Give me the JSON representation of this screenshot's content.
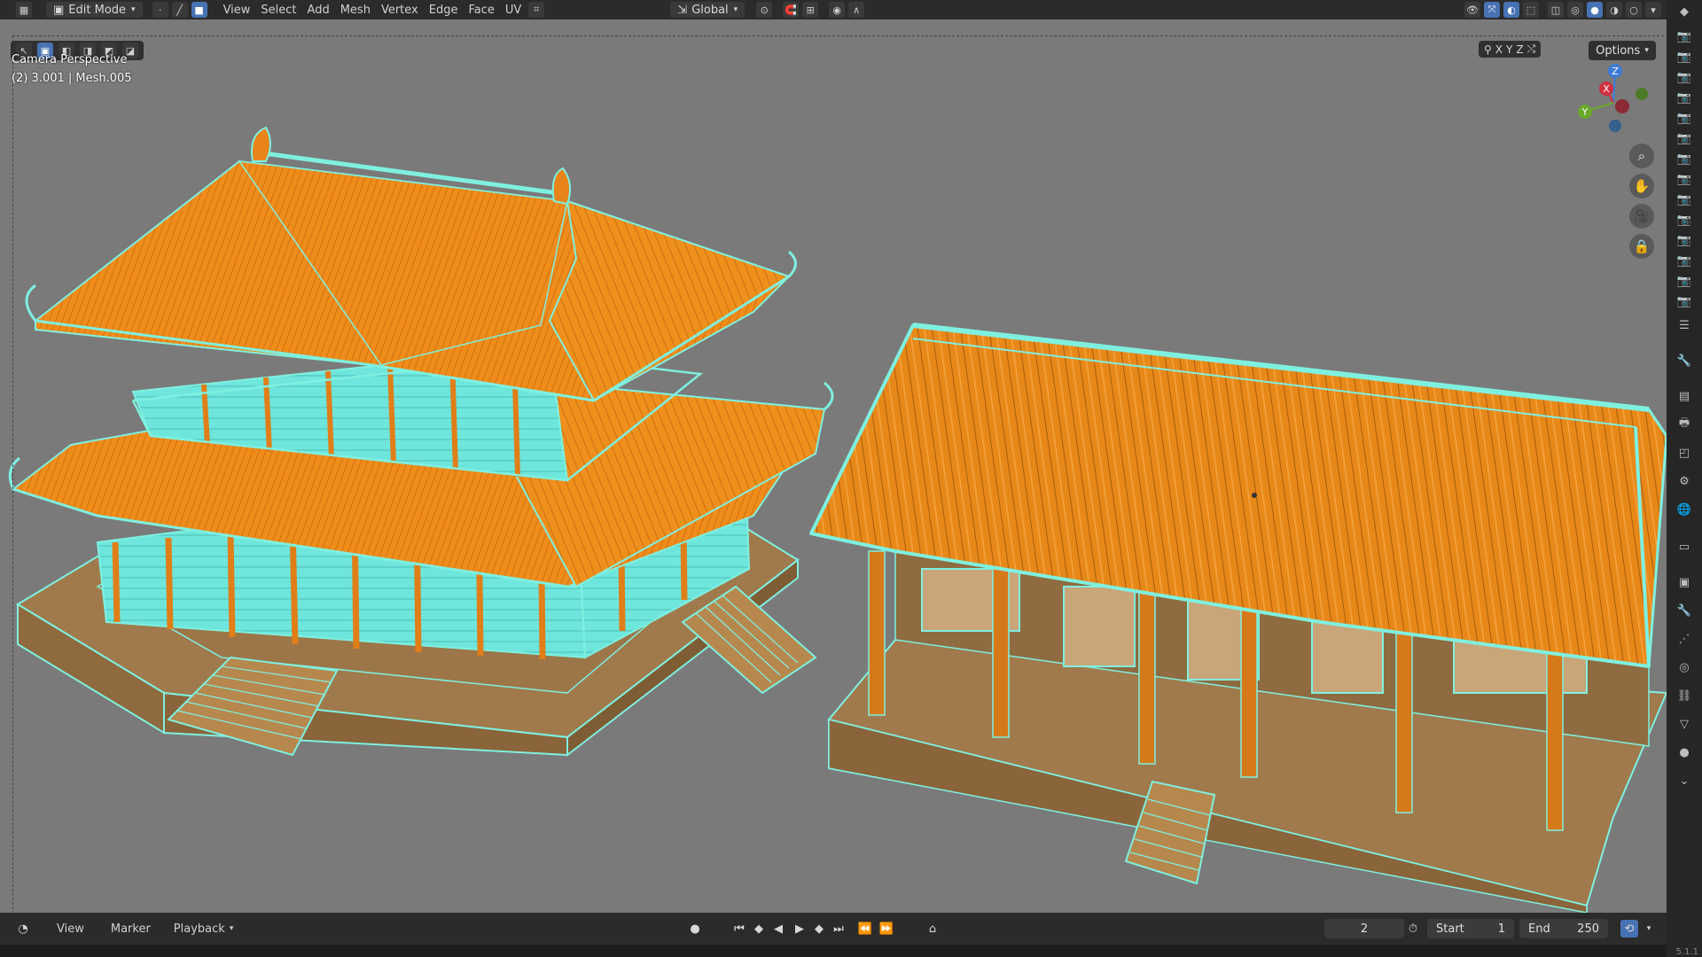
{
  "topbar": {
    "mode": "Edit Mode",
    "menus": [
      "View",
      "Select",
      "Add",
      "Mesh",
      "Vertex",
      "Edge",
      "Face",
      "UV"
    ],
    "orientation": "Global"
  },
  "viewport": {
    "camera_label": "Camera Perspective",
    "object_label": "(2) 3.001 | Mesh.005",
    "options_label": "Options",
    "axis_x": "X",
    "axis_y": "Y",
    "axis_z": "Z",
    "gizmo": {
      "x": "X",
      "y": "Y",
      "z": "Z"
    },
    "background_color": "#7a7a7a",
    "mesh_fill_color": "#f08c1a",
    "wire_color": "#7ff0e0"
  },
  "timeline": {
    "menus": [
      "View",
      "Marker",
      "Playback"
    ],
    "current_frame": "2",
    "start_label": "Start",
    "start_value": "1",
    "end_label": "End",
    "end_value": "250"
  },
  "status": {
    "version": "5.1.1"
  }
}
